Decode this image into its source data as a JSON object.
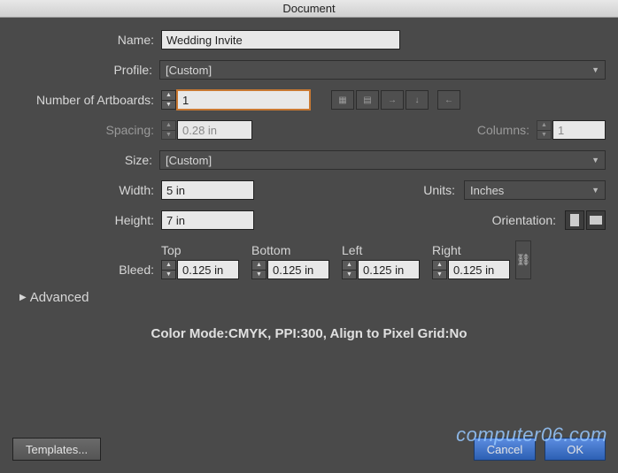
{
  "title_fragment": "Document",
  "labels": {
    "name": "Name:",
    "profile": "Profile:",
    "artboards": "Number of Artboards:",
    "spacing": "Spacing:",
    "columns": "Columns:",
    "size": "Size:",
    "width": "Width:",
    "height": "Height:",
    "units": "Units:",
    "orientation": "Orientation:",
    "bleed": "Bleed:",
    "top": "Top",
    "bottom": "Bottom",
    "left": "Left",
    "right": "Right",
    "advanced": "Advanced"
  },
  "fields": {
    "name": "Wedding Invite",
    "profile": "[Custom]",
    "artboards": "1",
    "spacing": "0.28 in",
    "columns": "1",
    "size": "[Custom]",
    "width": "5 in",
    "height": "7 in",
    "units": "Inches",
    "bleed_top": "0.125 in",
    "bleed_bottom": "0.125 in",
    "bleed_left": "0.125 in",
    "bleed_right": "0.125 in"
  },
  "status": "Color Mode:CMYK, PPI:300, Align to Pixel Grid:No",
  "buttons": {
    "templates": "Templates...",
    "cancel": "Cancel",
    "ok": "OK"
  },
  "watermark": "computer06.com"
}
